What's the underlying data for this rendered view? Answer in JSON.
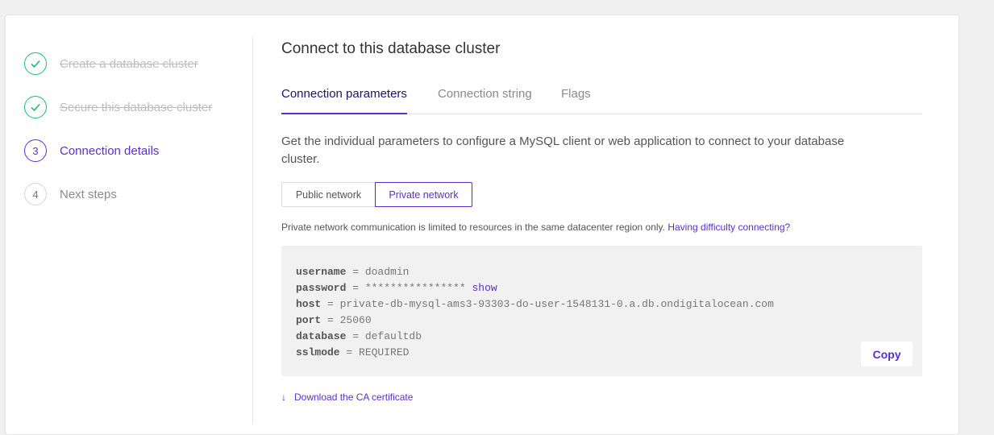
{
  "steps": [
    {
      "number": "",
      "label": "Create a database cluster",
      "state": "done"
    },
    {
      "number": "",
      "label": "Secure this database cluster",
      "state": "done"
    },
    {
      "number": "3",
      "label": "Connection details",
      "state": "active"
    },
    {
      "number": "4",
      "label": "Next steps",
      "state": "todo"
    }
  ],
  "title": "Connect to this database cluster",
  "tabs": [
    {
      "label": "Connection parameters",
      "active": true
    },
    {
      "label": "Connection string",
      "active": false
    },
    {
      "label": "Flags",
      "active": false
    }
  ],
  "description": "Get the individual parameters to configure a MySQL client or web application to connect to your database cluster.",
  "network": {
    "public_label": "Public network",
    "private_label": "Private network",
    "selected": "private"
  },
  "note": {
    "text": "Private network communication is limited to resources in the same datacenter region only.",
    "link": "Having difficulty connecting?"
  },
  "params": {
    "username": {
      "key": "username",
      "value": "doadmin"
    },
    "password": {
      "key": "password",
      "value": "****************",
      "show_label": "show"
    },
    "host": {
      "key": "host",
      "value": "private-db-mysql-ams3-93303-do-user-1548131-0.a.db.ondigitalocean.com"
    },
    "port": {
      "key": "port",
      "value": "25060"
    },
    "database": {
      "key": "database",
      "value": "defaultdb"
    },
    "sslmode": {
      "key": "sslmode",
      "value": "REQUIRED"
    },
    "separator": " = "
  },
  "copy_label": "Copy",
  "download_label": "Download the CA certificate",
  "colors": {
    "accent": "#5b2ed1",
    "success": "#15c26b"
  }
}
